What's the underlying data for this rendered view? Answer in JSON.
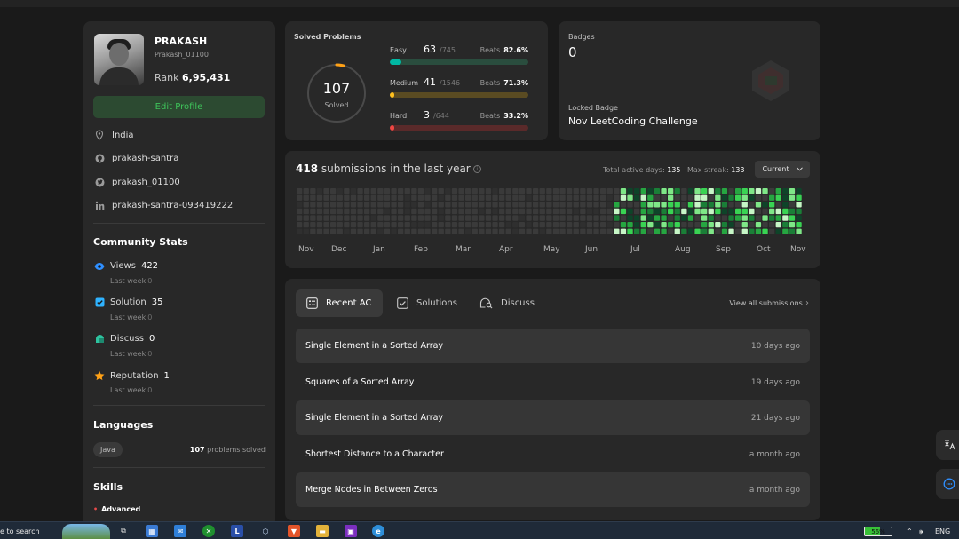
{
  "profile": {
    "name": "PRAKASH",
    "handle": "Prakash_01100",
    "rank_label": "Rank",
    "rank_value": "6,95,431",
    "edit_label": "Edit Profile",
    "location": "India",
    "github": "prakash-santra",
    "twitter": "prakash_01100",
    "linkedin": "prakash-santra-093419222"
  },
  "community": {
    "title": "Community Stats",
    "last_week_label": "Last week",
    "items": [
      {
        "label": "Views",
        "value": "422",
        "delta": "0",
        "color": "#2f8fff"
      },
      {
        "label": "Solution",
        "value": "35",
        "delta": "0",
        "color": "#2fb3ff"
      },
      {
        "label": "Discuss",
        "value": "0",
        "delta": "0",
        "color": "#2ec4a0"
      },
      {
        "label": "Reputation",
        "value": "1",
        "delta": "0",
        "color": "#ffa116"
      }
    ]
  },
  "languages": {
    "title": "Languages",
    "items": [
      {
        "name": "Java",
        "count": "107",
        "suffix": "problems solved"
      }
    ]
  },
  "skills": {
    "title": "Skills",
    "level": "Advanced"
  },
  "solved": {
    "title": "Solved Problems",
    "total": "107",
    "total_label": "Solved",
    "ring_fraction": 0.04,
    "beats_label": "Beats",
    "difficulties": [
      {
        "name": "Easy",
        "solved": "63",
        "total": "/745",
        "beats": "82.6%",
        "fraction": 0.085,
        "fill": "#00b8a3",
        "track": "#2a4d3e"
      },
      {
        "name": "Medium",
        "solved": "41",
        "total": "/1546",
        "beats": "71.3%",
        "fraction": 0.027,
        "fill": "#ffc01e",
        "track": "#5a4b22"
      },
      {
        "name": "Hard",
        "solved": "3",
        "total": "/644",
        "beats": "33.2%",
        "fraction": 0.005,
        "fill": "#ef4743",
        "track": "#5a2a2a"
      }
    ]
  },
  "badges": {
    "title": "Badges",
    "count": "0",
    "locked_label": "Locked Badge",
    "locked_name": "Nov LeetCoding Challenge"
  },
  "submissions": {
    "count": "418",
    "text": "submissions in the last year",
    "active_label": "Total active days:",
    "active_value": "135",
    "streak_label": "Max streak:",
    "streak_value": "133",
    "current_label": "Current",
    "months": [
      "Nov",
      "Dec",
      "Jan",
      "Feb",
      "Mar",
      "Apr",
      "May",
      "Jun",
      "Jul",
      "Aug",
      "Sep",
      "Oct",
      "Nov"
    ]
  },
  "recent": {
    "tabs": [
      {
        "label": "Recent AC",
        "icon": "list-icon"
      },
      {
        "label": "Solutions",
        "icon": "check-square-icon"
      },
      {
        "label": "Discuss",
        "icon": "chat-search-icon"
      }
    ],
    "view_all": "View all submissions",
    "items": [
      {
        "title": "Single Element in a Sorted Array",
        "ago": "10 days ago"
      },
      {
        "title": "Squares of a Sorted Array",
        "ago": "19 days ago"
      },
      {
        "title": "Single Element in a Sorted Array",
        "ago": "21 days ago"
      },
      {
        "title": "Shortest Distance to a Character",
        "ago": "a month ago"
      },
      {
        "title": "Merge Nodes in Between Zeros",
        "ago": "a month ago"
      }
    ]
  },
  "taskbar": {
    "search_text": "e to search",
    "battery": "56%",
    "battery_fraction": 0.56,
    "lang": "ENG"
  }
}
